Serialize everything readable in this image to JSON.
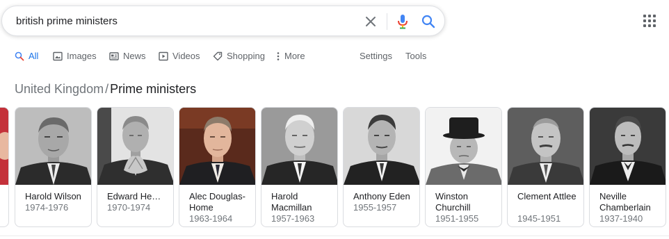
{
  "search": {
    "query": "british prime ministers"
  },
  "tabs": [
    {
      "label": "All",
      "icon": "search-icon",
      "active": true
    },
    {
      "label": "Images",
      "icon": "image-icon",
      "active": false
    },
    {
      "label": "News",
      "icon": "news-icon",
      "active": false
    },
    {
      "label": "Videos",
      "icon": "video-icon",
      "active": false
    },
    {
      "label": "Shopping",
      "icon": "tag-icon",
      "active": false
    },
    {
      "label": "More",
      "icon": "more-vert-icon",
      "active": false
    },
    {
      "label": "Settings",
      "active": false
    },
    {
      "label": "Tools",
      "active": false
    }
  ],
  "heading": {
    "crumb": "United Kingdom",
    "separator": "/",
    "current": "Prime ministers"
  },
  "ministers": [
    {
      "name": "Harold Wilson",
      "years": "1974-1976"
    },
    {
      "name": "Edward He…",
      "years": "1970-1974"
    },
    {
      "name": "Alec Douglas-Home",
      "years": "1963-1964"
    },
    {
      "name": "Harold Macmillan",
      "years": "1957-1963"
    },
    {
      "name": "Anthony Eden",
      "years": "1955-1957"
    },
    {
      "name": "Winston Churchill",
      "years": "1951-1955"
    },
    {
      "name": "Clement Attlee",
      "years": "1945-1951"
    },
    {
      "name": "Neville Chamberlain",
      "years": "1937-1940"
    }
  ],
  "colors": {
    "accent": "#1a73e8",
    "text": "#202124",
    "secondary": "#70757a",
    "mic_blue": "#4285f4",
    "mic_red": "#ea4335",
    "mic_yellow": "#fbbc04",
    "mic_green": "#34a853"
  }
}
